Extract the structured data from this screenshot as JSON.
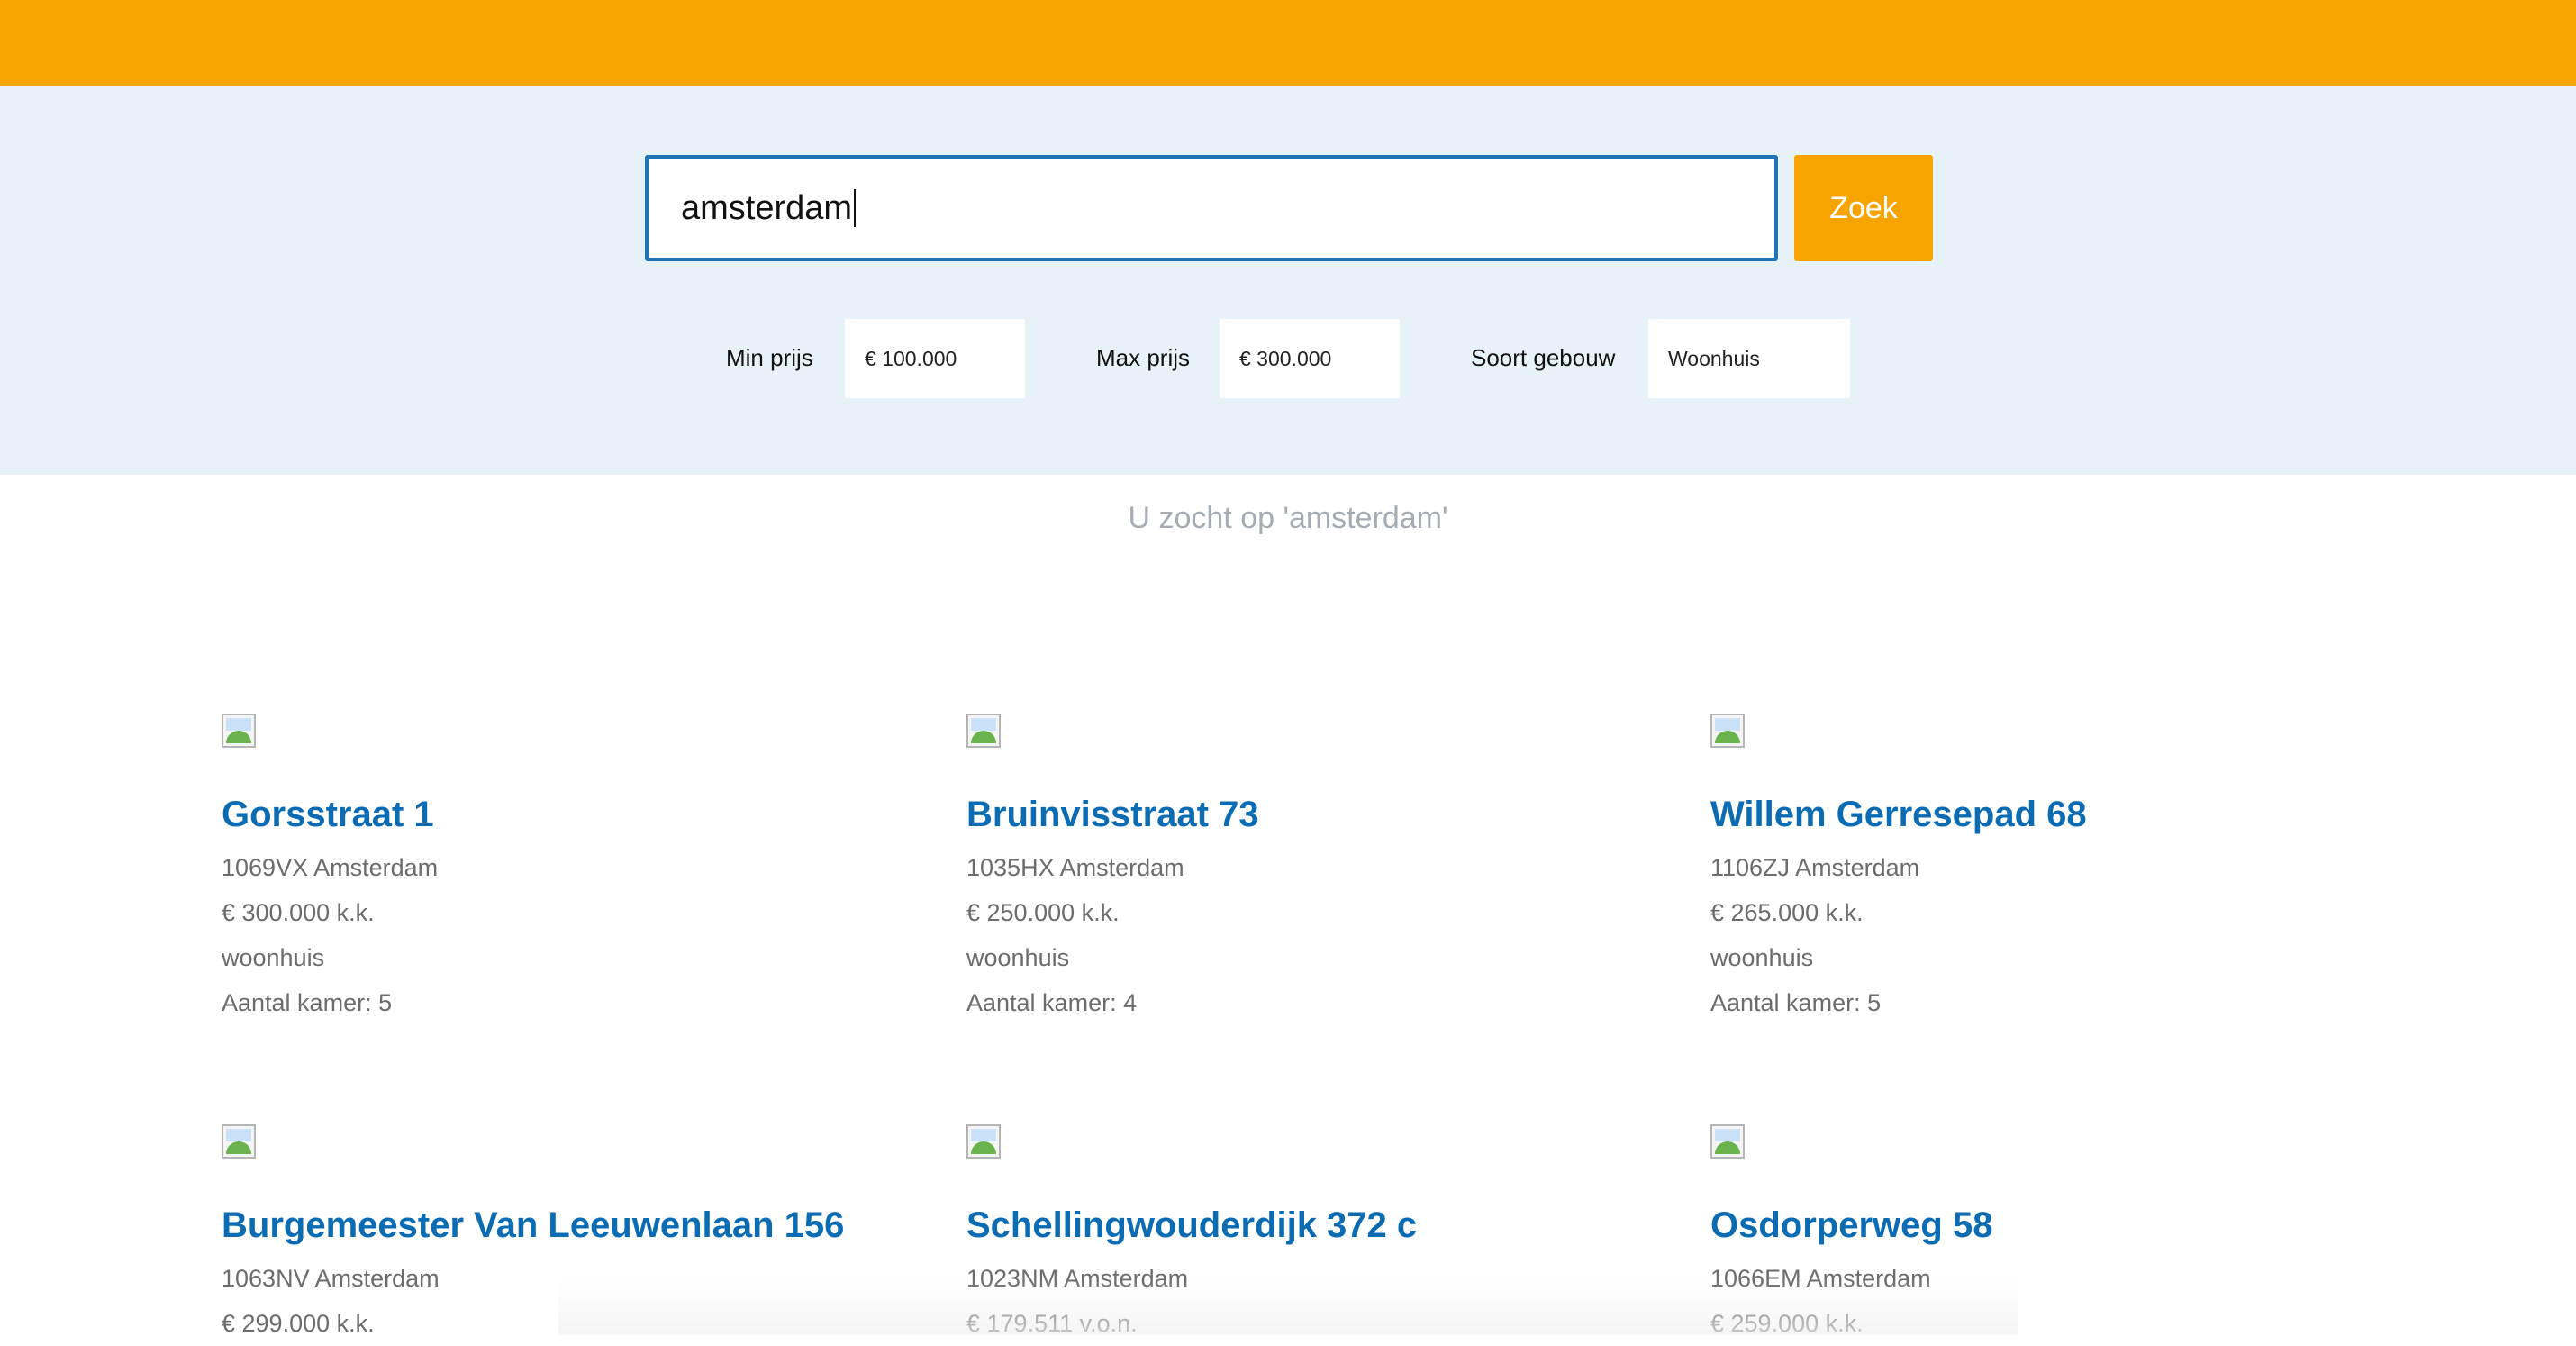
{
  "search": {
    "query": "amsterdam",
    "button_label": "Zoek"
  },
  "filters": {
    "min_price_label": "Min prijs",
    "min_price_value": "€ 100.000",
    "max_price_label": "Max prijs",
    "max_price_value": "€ 300.000",
    "building_type_label": "Soort gebouw",
    "building_type_value": "Woonhuis"
  },
  "results_heading": "U zocht op 'amsterdam'",
  "listings": [
    {
      "address": "Gorsstraat 1",
      "postal": "1069VX Amsterdam",
      "price": "€ 300.000 k.k.",
      "type": "woonhuis",
      "rooms": "Aantal kamer: 5"
    },
    {
      "address": "Bruinvisstraat 73",
      "postal": "1035HX Amsterdam",
      "price": "€ 250.000 k.k.",
      "type": "woonhuis",
      "rooms": "Aantal kamer: 4"
    },
    {
      "address": "Willem Gerresepad 68",
      "postal": "1106ZJ Amsterdam",
      "price": "€ 265.000 k.k.",
      "type": "woonhuis",
      "rooms": "Aantal kamer: 5"
    },
    {
      "address": "Burgemeester Van Leeuwenlaan 156",
      "postal": "1063NV Amsterdam",
      "price": "€ 299.000 k.k."
    },
    {
      "address": "Schellingwouderdijk 372 c",
      "postal": "1023NM Amsterdam",
      "price": "€ 179.511 v.o.n."
    },
    {
      "address": "Osdorperweg 58",
      "postal": "1066EM Amsterdam",
      "price": "€ 259.000 k.k."
    }
  ],
  "colors": {
    "brand_orange": "#f7a300",
    "search_bg": "#e7f1f8",
    "link_blue": "#0b6cb3"
  }
}
